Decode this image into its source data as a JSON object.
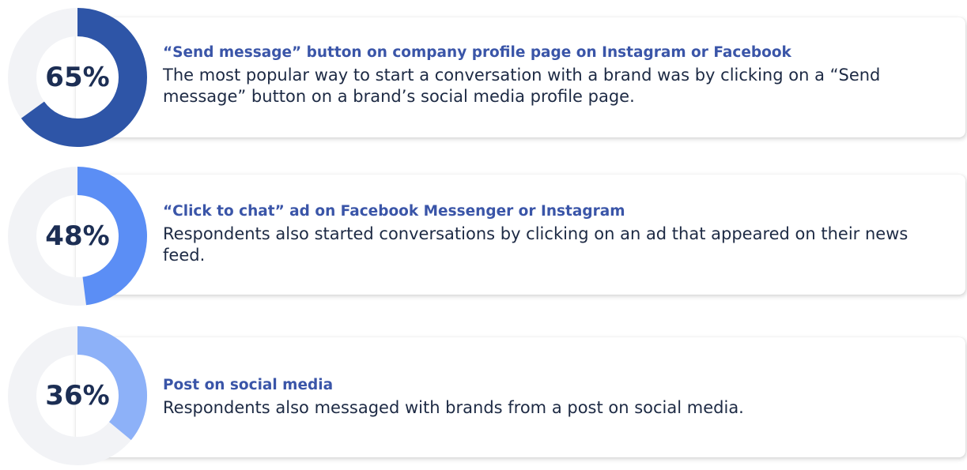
{
  "chart_data": {
    "type": "donut",
    "items": [
      {
        "percent_label": "65%",
        "value": 65,
        "color": "#2e55a7",
        "title": "“Send message” button on company profile page on Instagram or Facebook",
        "description": "The most popular way to start a conversation with a brand was by clicking on a “Send message” button on a brand’s social media profile page."
      },
      {
        "percent_label": "48%",
        "value": 48,
        "color": "#5b8ef5",
        "title": "“Click to chat” ad on Facebook Messenger or Instagram",
        "description": "Respondents also started conversations by clicking on an ad that appeared on their news feed."
      },
      {
        "percent_label": "36%",
        "value": 36,
        "color": "#8db1f8",
        "title": "Post on social media",
        "description": "Respondents also messaged with brands from a post on social media."
      }
    ],
    "track_color": "#f2f3f6"
  }
}
